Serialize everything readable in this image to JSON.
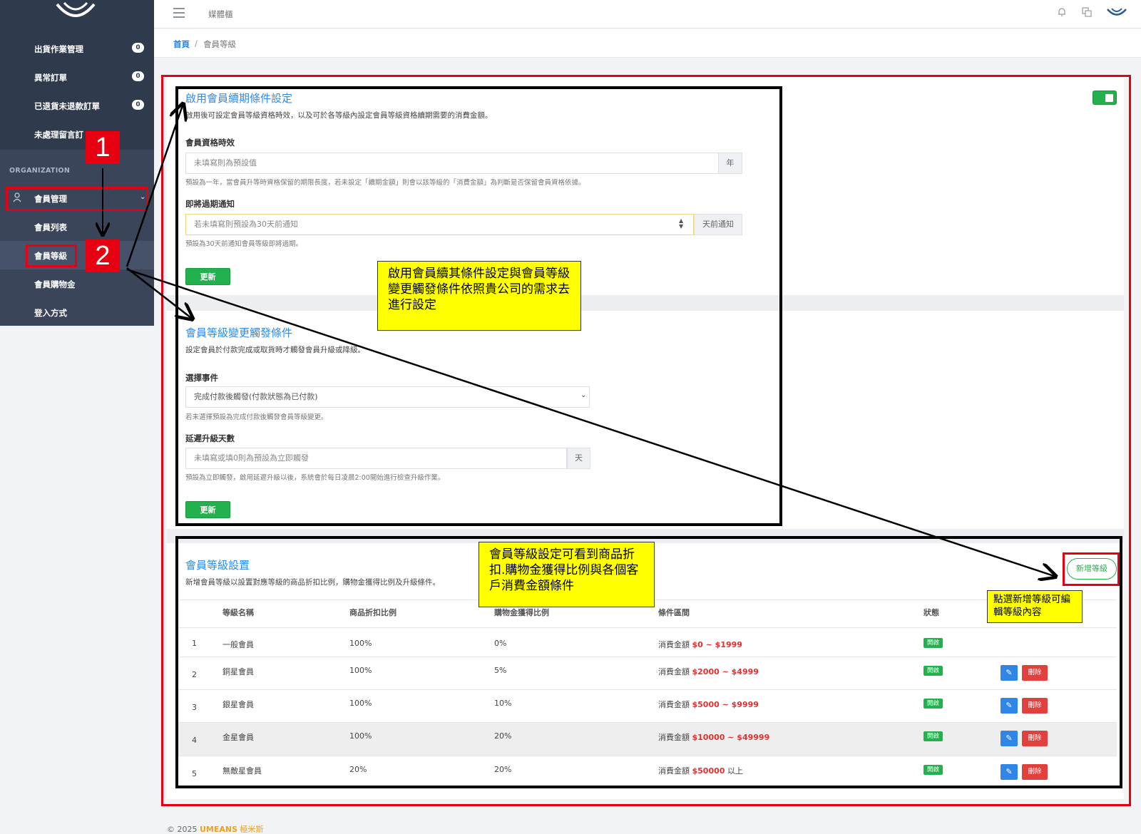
{
  "sidebar": {
    "items": [
      {
        "label": "出貨作業管理",
        "badge": "0"
      },
      {
        "label": "異常訂單",
        "badge": "0"
      },
      {
        "label": "已退貨未退款訂單",
        "badge": "0"
      },
      {
        "label": "未處理留言訂"
      }
    ],
    "section_label": "ORGANIZATION",
    "member_mgmt": "會員管理",
    "sub_items": [
      "會員列表",
      "會員等級",
      "會員購物金",
      "登入方式"
    ]
  },
  "topbar": {
    "title": "媒體櫃"
  },
  "breadcrumb": {
    "home": "首頁",
    "sep": "/",
    "current": "會員等級"
  },
  "renewal": {
    "title": "啟用會員續期條件設定",
    "desc": "啟用後可設定會員等級資格時效，以及可於各等級內設定會員等級資格續期需要的消費金額。",
    "validity_label": "會員資格時效",
    "validity_placeholder": "未填寫則為預設值",
    "validity_unit": "年",
    "validity_help": "預設為一年，當會員升等時資格保留的期限長度，若未設定「續期金額」則會以該等級的「消費金額」為判斷是否保留會員資格依據。",
    "expire_label": "即將過期通知",
    "expire_placeholder": "若未填寫則預設為30天前通知",
    "expire_unit": "天前通知",
    "expire_help": "預設為30天前通知會員等級即將過期。",
    "update_btn": "更新"
  },
  "trigger": {
    "title": "會員等級變更觸發條件",
    "desc": "設定會員於付款完成或取貨時才觸發會員升級或降級。",
    "event_label": "選擇事件",
    "event_value": "完成付款後觸發(付款狀態為已付款)",
    "event_help": "若未選擇預設為完成付款後觸發會員等級變更。",
    "delay_label": "延遲升級天數",
    "delay_placeholder": "未填寫或填0則為預設為立即觸發",
    "delay_unit": "天",
    "delay_help": "預設為立即觸發，啟用延遲升級以後，系統會於每日凌晨2:00開始進行檢查升級作業。",
    "update_btn": "更新"
  },
  "levels": {
    "title": "會員等級設置",
    "desc": "新增會員等級以設置對應等級的商品折扣比例，購物金獲得比例及升級條件。",
    "add_btn": "新增等級",
    "headers": [
      "等級名稱",
      "商品折扣比例",
      "購物金獲得比例",
      "條件區間",
      "狀態"
    ],
    "rows": [
      {
        "no": "1",
        "name": "一般會員",
        "discount": "100%",
        "reward": "0%",
        "cond_prefix": "消費金額",
        "cond_range": "$0 ~ $1999",
        "cond_suffix": "",
        "status": "開啟"
      },
      {
        "no": "2",
        "name": "銅星會員",
        "discount": "100%",
        "reward": "5%",
        "cond_prefix": "消費金額",
        "cond_range": "$2000 ~ $4999",
        "cond_suffix": "",
        "status": "開啟",
        "edit": "✎",
        "del": "刪除"
      },
      {
        "no": "3",
        "name": "銀星會員",
        "discount": "100%",
        "reward": "10%",
        "cond_prefix": "消費金額",
        "cond_range": "$5000 ~ $9999",
        "cond_suffix": "",
        "status": "開啟",
        "edit": "✎",
        "del": "刪除"
      },
      {
        "no": "4",
        "name": "金星會員",
        "discount": "100%",
        "reward": "20%",
        "cond_prefix": "消費金額",
        "cond_range": "$10000 ~ $49999",
        "cond_suffix": "",
        "status": "開啟",
        "edit": "✎",
        "del": "刪除"
      },
      {
        "no": "5",
        "name": "無敵星會員",
        "discount": "20%",
        "reward": "20%",
        "cond_prefix": "消費金額",
        "cond_range": "$50000",
        "cond_suffix": "以上",
        "status": "開啟",
        "edit": "✎",
        "del": "刪除"
      }
    ]
  },
  "annotations": {
    "step1": "1",
    "step2": "2",
    "note_settings": "啟用會員續其條件設定與會員等級變更觸發條件依照貴公司的需求去進行設定",
    "note_levels": "會員等級設定可看到商品折扣.購物金獲得比例與各個客戶消費金額條件",
    "note_add": "點選新增等級可編輯等級內容"
  },
  "footer": {
    "copyright": "© 2025",
    "brand": "UMEANS",
    "brand_cn": "極米斯"
  },
  "colors": {
    "accent": "#2e8be6",
    "success": "#22b14c",
    "danger": "#e0413d",
    "sidebar": "#2f3a4d",
    "annotation_red": "#e60012",
    "note_yellow": "#ffff00"
  }
}
